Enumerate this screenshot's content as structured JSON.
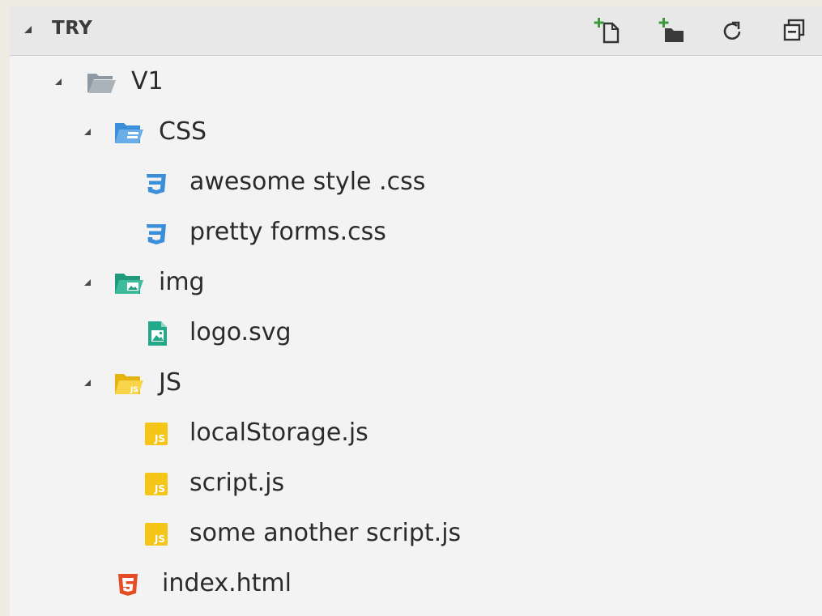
{
  "explorer": {
    "section_title": "TRY",
    "toolbar": [
      {
        "name": "new-file-icon"
      },
      {
        "name": "new-folder-icon"
      },
      {
        "name": "refresh-icon"
      },
      {
        "name": "collapse-all-icon"
      }
    ]
  },
  "tree": [
    {
      "label": "V1",
      "type": "folder",
      "depth": 0,
      "expanded": true,
      "icon": "folder-open-icon",
      "color": "#9aa3ad"
    },
    {
      "label": "CSS",
      "type": "folder",
      "depth": 1,
      "expanded": true,
      "icon": "css-folder-icon",
      "color": "#3b8fd9"
    },
    {
      "label": "awesome style .css",
      "type": "file",
      "depth": 2,
      "icon": "css3-file-icon",
      "color": "#3b8fd9"
    },
    {
      "label": "pretty forms.css",
      "type": "file",
      "depth": 2,
      "icon": "css3-file-icon",
      "color": "#3b8fd9"
    },
    {
      "label": "img",
      "type": "folder",
      "depth": 1,
      "expanded": true,
      "icon": "image-folder-icon",
      "color": "#23a88a"
    },
    {
      "label": "logo.svg",
      "type": "file",
      "depth": 2,
      "icon": "image-file-icon",
      "color": "#23a88a"
    },
    {
      "label": "JS",
      "type": "folder",
      "depth": 1,
      "expanded": true,
      "icon": "js-folder-icon",
      "color": "#f5c518"
    },
    {
      "label": "localStorage.js",
      "type": "file",
      "depth": 2,
      "icon": "js-file-icon",
      "color": "#f5c518"
    },
    {
      "label": "script.js",
      "type": "file",
      "depth": 2,
      "icon": "js-file-icon",
      "color": "#f5c518"
    },
    {
      "label": "some another script.js",
      "type": "file",
      "depth": 2,
      "icon": "js-file-icon",
      "color": "#f5c518"
    },
    {
      "label": "index.html",
      "type": "file",
      "depth": 1,
      "icon": "html5-file-icon",
      "color": "#e44d26"
    }
  ]
}
